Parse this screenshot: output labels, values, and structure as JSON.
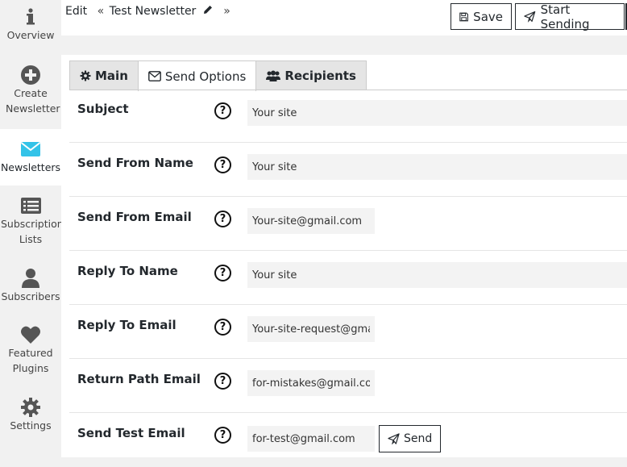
{
  "sidebar": {
    "items": [
      {
        "label": "Overview",
        "icon": "info-icon"
      },
      {
        "label": "Create Newsletter",
        "icon": "plus-circle-icon"
      },
      {
        "label": "Newsletters",
        "icon": "envelope-icon",
        "active": true
      },
      {
        "label": "Subscription Lists",
        "icon": "list-icon"
      },
      {
        "label": "Subscribers",
        "icon": "user-icon"
      },
      {
        "label": "Featured Plugins",
        "icon": "heart-icon"
      },
      {
        "label": "Settings",
        "icon": "gear-icon"
      }
    ]
  },
  "header": {
    "edit": "Edit",
    "quote_open": "«",
    "newsletter_name": "Test Newsletter",
    "quote_close": "»",
    "save_label": "Save",
    "start_sending_label": "Start Sending"
  },
  "tabs": [
    {
      "label": "Main",
      "icon": "gear-icon"
    },
    {
      "label": "Send Options",
      "icon": "envelope-icon",
      "active": true
    },
    {
      "label": "Recipients",
      "icon": "users-icon"
    }
  ],
  "form": {
    "subject": {
      "label": "Subject",
      "value": "Your site"
    },
    "send_from_name": {
      "label": "Send From Name",
      "value": "Your site"
    },
    "send_from_email": {
      "label": "Send From Email",
      "value": "Your-site@gmail.com"
    },
    "reply_to_name": {
      "label": "Reply To Name",
      "value": "Your site"
    },
    "reply_to_email": {
      "label": "Reply To Email",
      "value": "Your-site-request@gmail.com"
    },
    "return_path_email": {
      "label": "Return Path Email",
      "value": "for-mistakes@gmail.com"
    },
    "send_test_email": {
      "label": "Send Test Email",
      "value": "for-test@gmail.com",
      "button": "Send"
    }
  },
  "help_glyph": "?",
  "colors": {
    "accent": "#23282d",
    "active_icon": "#33c3e8",
    "background": "#f1f1f1"
  }
}
